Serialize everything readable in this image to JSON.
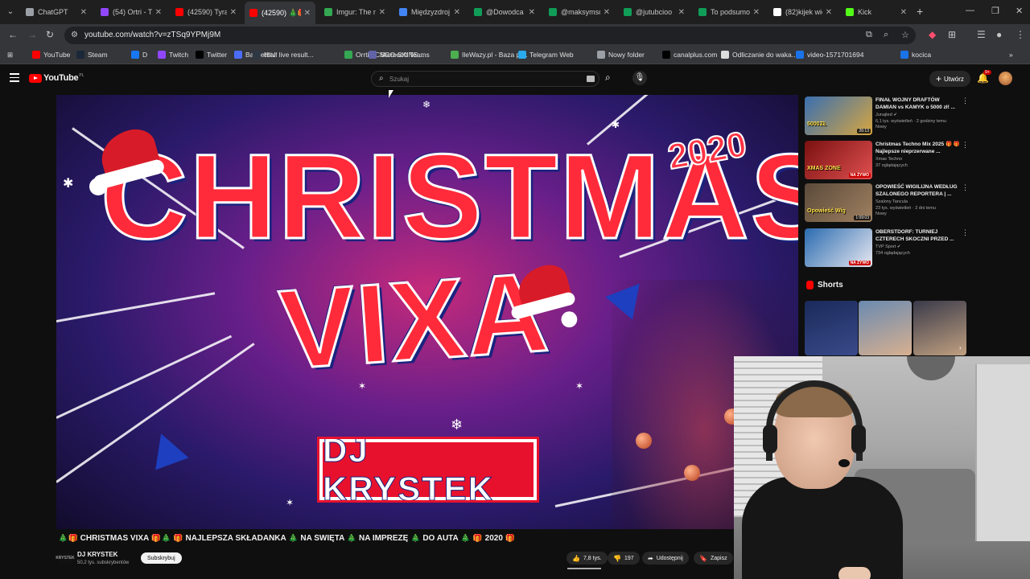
{
  "tabs": [
    {
      "title": "ChatGPT",
      "favicon_color": "#9aa0a6",
      "active": false
    },
    {
      "title": "(54) Ortri - T",
      "favicon_color": "#9146ff",
      "active": false
    },
    {
      "title": "(42590) Tyra",
      "favicon_color": "#ff0000",
      "active": false
    },
    {
      "title": "(42590) 🎄🎁",
      "favicon_color": "#ff0000",
      "active": true
    },
    {
      "title": "Imgur: The m",
      "favicon_color": "#34a853",
      "active": false
    },
    {
      "title": "Międzyzdroj",
      "favicon_color": "#4285f4",
      "active": false
    },
    {
      "title": "@Dowodca",
      "favicon_color": "#0f9d58",
      "active": false
    },
    {
      "title": "@maksymsc",
      "favicon_color": "#0f9d58",
      "active": false
    },
    {
      "title": "@jutubcioo",
      "favicon_color": "#0f9d58",
      "active": false
    },
    {
      "title": "To podsumo",
      "favicon_color": "#0f9d58",
      "active": false
    },
    {
      "title": "(82)kijek wio",
      "favicon_color": "#ffffff",
      "active": false
    },
    {
      "title": "Kick",
      "favicon_color": "#53fc18",
      "active": false
    }
  ],
  "address": {
    "url": "youtube.com/watch?v=zTSq9YPMj9M"
  },
  "bookmarks": [
    {
      "label": "YouTube",
      "color": "#ff0000"
    },
    {
      "label": "Steam",
      "color": "#1b2838"
    },
    {
      "label": "D",
      "color": "#1877f2"
    },
    {
      "label": "Twitch",
      "color": "#9146ff"
    },
    {
      "label": "Twitter",
      "color": "#000000"
    },
    {
      "label": "Basketball live result...",
      "color": "#4a6cf7"
    },
    {
      "label": "Hltv",
      "color": "#2d3844"
    },
    {
      "label": "Orrti - CSGO-SKINS...",
      "color": "#34a853"
    },
    {
      "label": "Microsoft Teams",
      "color": "#6264a7"
    },
    {
      "label": "IleWazy.pl - Baza pr...",
      "color": "#4caf50"
    },
    {
      "label": "Telegram Web",
      "color": "#2aabee"
    },
    {
      "label": "Nowy folder",
      "color": "#9aa0a6"
    },
    {
      "label": "canalplus.com",
      "color": "#000000"
    },
    {
      "label": "Odliczanie do waka...",
      "color": "#dddddd"
    },
    {
      "label": "video-1571701694",
      "color": "#1a73e8"
    },
    {
      "label": "kocica",
      "color": "#1a73e8"
    }
  ],
  "youtube": {
    "logo_text": "YouTube",
    "country": "PL",
    "search_placeholder": "Szukaj",
    "create_label": "Utwórz",
    "notif_badge": "9+"
  },
  "video": {
    "thumb_title_1": "CHRISTMAS",
    "thumb_title_2": "VIXA",
    "thumb_year": "2020",
    "thumb_dj": "DJ KRYSTEK",
    "title": "🎄🎁 CHRISTMAS VIXA 🎁🎄 🎁 NAJLEPSZA SKŁADANKA 🎄 NA ŚWIĘTA 🎄 NA IMPREZĘ 🎄 DO AUTA 🎄 🎁 2020 🎁",
    "channel_avatar": "KRYSTEK",
    "channel": "DJ KRYSTEK",
    "subscribers": "50,2 tys. subskrybentów",
    "subscribe_label": "Subskrybuj",
    "likes": "7,8 tys.",
    "dislikes": "197",
    "share_label": "Udostępnij",
    "save_label": "Zapisz"
  },
  "sidebar": {
    "recommendations": [
      {
        "title": "FINAŁ WOJNY DRAFTÓW DAMIAN vs KAMYK o 5000 zł! ...",
        "channel": "Junajted ✔",
        "meta_line1": "6,1 tys. wyświetleń · 2 godziny temu",
        "meta_line2": "Nowy",
        "badge": "26:13",
        "badge_type": "duration",
        "thumb_text": "5000ZŁ",
        "thumb_colors": [
          "#3a6fb0",
          "#d7a640"
        ]
      },
      {
        "title": "Christmas Techno Mix 2025 🎁 🎁 Najlepsze nieprzerwane ...",
        "channel": "Xmas Techno",
        "meta_line1": "37 oglądających",
        "meta_line2": "",
        "badge": "NA ŻYWO",
        "badge_type": "live",
        "thumb_text": "XMAS ZONE",
        "thumb_colors": [
          "#7a1010",
          "#e05050"
        ]
      },
      {
        "title": "OPOWIEŚĆ WIGILIJNA WEDŁUG SZALONEGO REPORTERA | ...",
        "channel": "Szalony Tancula",
        "meta_line1": "23 tys. wyświetleń · 2 dni temu",
        "meta_line2": "Nowy",
        "badge": "1:09:03",
        "badge_type": "duration",
        "thumb_text": "Opowieść Wig",
        "thumb_colors": [
          "#5a4a3a",
          "#a08060"
        ]
      },
      {
        "title": "OBERSTDORF: TURNIEJ CZTERECH SKOCZNI PRZED ...",
        "channel": "TVP Sport ✔",
        "meta_line1": "734 oglądających",
        "meta_line2": "",
        "badge": "NA ŻYWO",
        "badge_type": "live",
        "thumb_text": "",
        "thumb_colors": [
          "#2a6bb0",
          "#e8e8f0"
        ]
      }
    ],
    "shorts_label": "Shorts",
    "shorts": [
      {
        "colors": [
          "#1a2a5a",
          "#3a4a8a"
        ]
      },
      {
        "colors": [
          "#6a8ab0",
          "#d8b090"
        ]
      },
      {
        "colors": [
          "#3a3a4a",
          "#c0a080"
        ]
      }
    ]
  }
}
